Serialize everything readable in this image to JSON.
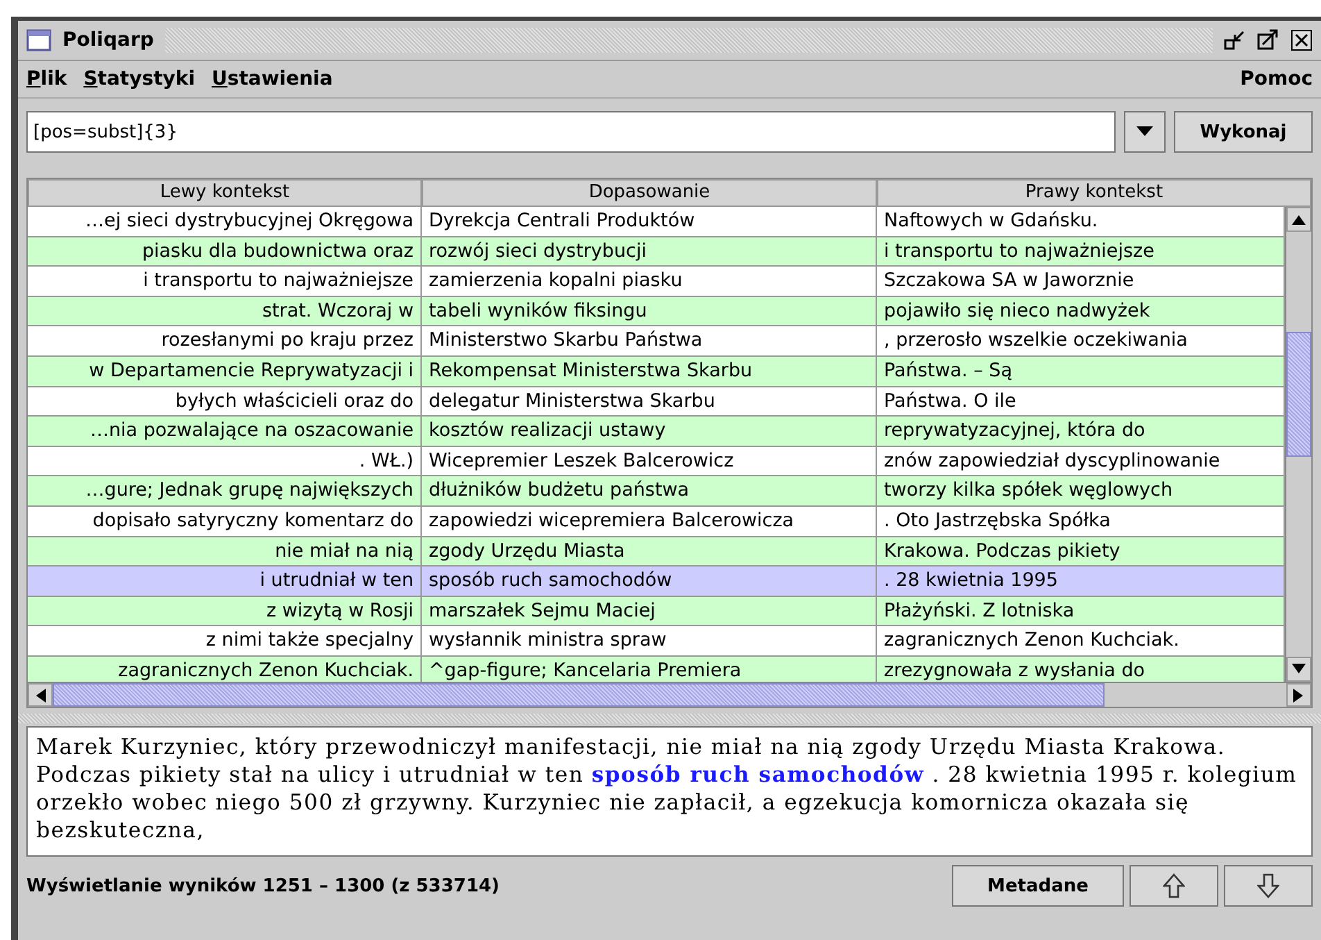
{
  "window": {
    "title": "Poliqarp"
  },
  "menu": {
    "left": [
      "Plik",
      "Statystyki",
      "Ustawienia"
    ],
    "right": "Pomoc"
  },
  "query": {
    "value": "[pos=subst]{3}",
    "run_button": "Wykonaj"
  },
  "table": {
    "columns": [
      "Lewy kontekst",
      "Dopasowanie",
      "Prawy kontekst"
    ],
    "rows": [
      {
        "cells": [
          "…ej sieci dystrybucyjnej Okręgowa",
          "Dyrekcja Centrali Produktów",
          "Naftowych w Gdańsku."
        ],
        "selected": false
      },
      {
        "cells": [
          "piasku dla budownictwa oraz",
          "rozwój sieci dystrybucji",
          "i transportu to najważniejsze"
        ],
        "selected": false
      },
      {
        "cells": [
          "i transportu to najważniejsze",
          "zamierzenia kopalni piasku",
          "Szczakowa SA w Jaworznie"
        ],
        "selected": false
      },
      {
        "cells": [
          "strat. Wczoraj w",
          "tabeli wyników fiksingu",
          "pojawiło się nieco nadwyżek"
        ],
        "selected": false
      },
      {
        "cells": [
          "rozesłanymi po kraju przez",
          "Ministerstwo Skarbu Państwa",
          ", przerosło wszelkie oczekiwania"
        ],
        "selected": false
      },
      {
        "cells": [
          "w Departamencie Reprywatyzacji i",
          "Rekompensat Ministerstwa Skarbu",
          "Państwa. – Są"
        ],
        "selected": false
      },
      {
        "cells": [
          "byłych właścicieli oraz do",
          "delegatur Ministerstwa Skarbu",
          "Państwa. O ile"
        ],
        "selected": false
      },
      {
        "cells": [
          "…nia pozwalające na oszacowanie",
          "kosztów realizacji ustawy",
          "reprywatyzacyjnej, która do"
        ],
        "selected": false
      },
      {
        "cells": [
          ". WŁ.)",
          "Wicepremier Leszek Balcerowicz",
          "znów zapowiedział dyscyplinowanie"
        ],
        "selected": false
      },
      {
        "cells": [
          "…gure; Jednak grupę największych",
          "dłużników budżetu państwa",
          "tworzy kilka spółek węglowych"
        ],
        "selected": false
      },
      {
        "cells": [
          "dopisało satyryczny komentarz do",
          "zapowiedzi wicepremiera Balcerowicza",
          ". Oto Jastrzębska Spółka"
        ],
        "selected": false
      },
      {
        "cells": [
          "nie miał na nią",
          "zgody Urzędu Miasta",
          "Krakowa. Podczas pikiety"
        ],
        "selected": false
      },
      {
        "cells": [
          "i utrudniał w ten",
          "sposób ruch samochodów",
          ". 28 kwietnia 1995"
        ],
        "selected": true
      },
      {
        "cells": [
          "z wizytą w Rosji",
          "marszałek Sejmu Maciej",
          "Płażyński. Z lotniska"
        ],
        "selected": false
      },
      {
        "cells": [
          "z nimi także specjalny",
          "wysłannik ministra spraw",
          "zagranicznych Zenon Kuchciak."
        ],
        "selected": false
      },
      {
        "cells": [
          "zagranicznych Zenon Kuchciak.",
          "^gap-figure; Kancelaria Premiera",
          "zrezygnowała z wysłania do"
        ],
        "selected": false
      }
    ]
  },
  "context": "Marek Kurzyniec, który przewodniczył manifestacji, nie miał na nią zgody Urzędu Miasta Krakowa. Podczas pikiety stał na ulicy i utrudniał w ten **sposób ruch samochodów** . 28 kwietnia 1995 r. kolegium orzekło wobec niego 500 zł grzywny. Kurzyniec nie zapłacił, a egzekucja komornicza okazała się bezskuteczna,",
  "status": {
    "text": "Wyświetlanie wyników 1251 – 1300 (z 533714)",
    "metadata_button": "Metadane"
  }
}
